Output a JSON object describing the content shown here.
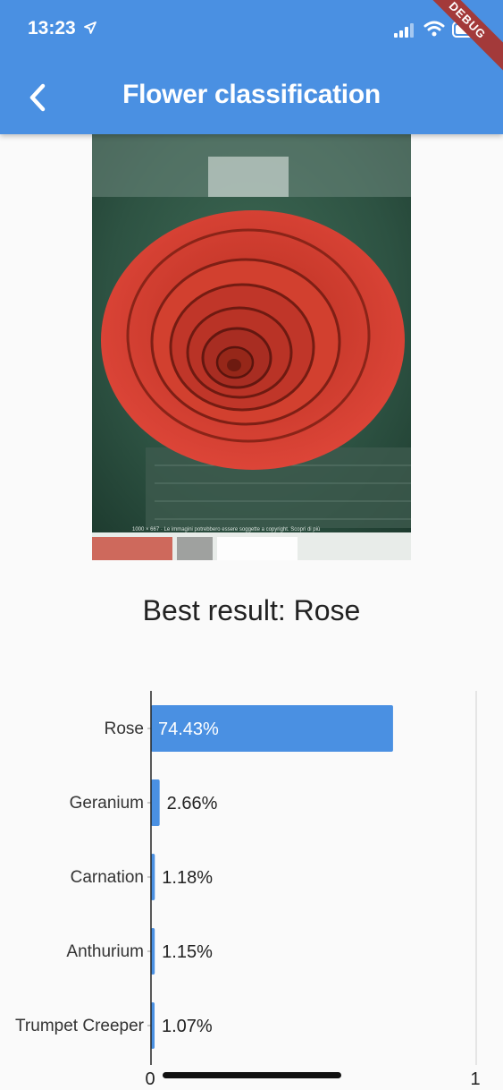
{
  "status_bar": {
    "time": "13:23",
    "debug_label": "DEBUG"
  },
  "app_bar": {
    "title": "Flower classification",
    "color": "#4a90e2"
  },
  "photo": {
    "caption_text": "1000 × 667 · Le immagini potrebbero essere soggette a copyright. Scopri di più"
  },
  "result": {
    "label": "Best result: Rose"
  },
  "chart_data": {
    "type": "bar",
    "orientation": "horizontal",
    "categories": [
      "Rose",
      "Geranium",
      "Carnation",
      "Anthurium",
      "Trumpet Creeper"
    ],
    "values": [
      0.7443,
      0.0266,
      0.0118,
      0.0115,
      0.0107
    ],
    "value_labels": [
      "74.43%",
      "2.66%",
      "1.18%",
      "1.15%",
      "1.07%"
    ],
    "xlim": [
      0,
      1
    ],
    "x_tick_labels": [
      "0",
      "1"
    ],
    "bar_color": "#4a90e2",
    "grid": false
  }
}
